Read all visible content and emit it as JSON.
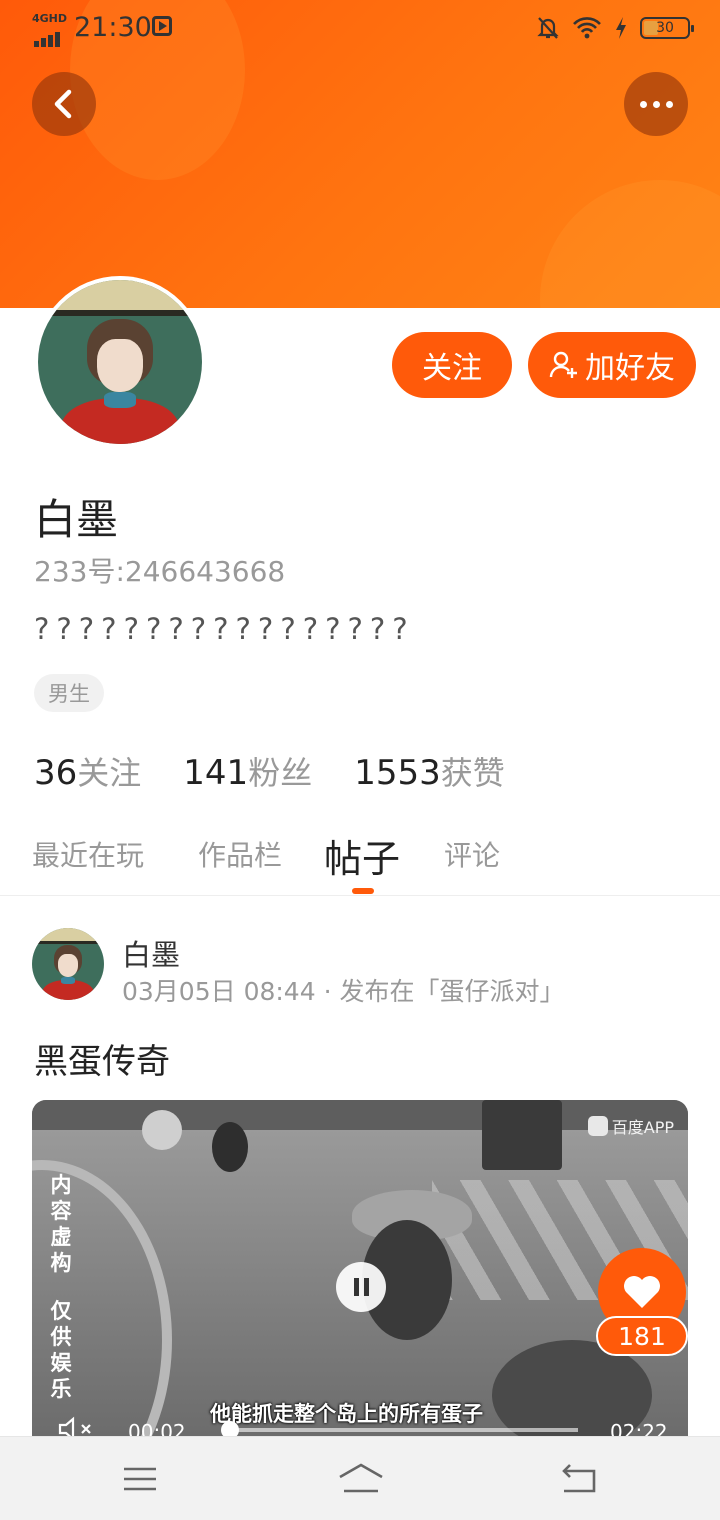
{
  "status_bar": {
    "network": "4GHD",
    "time": "21:30",
    "battery": "30"
  },
  "profile": {
    "name": "白墨",
    "uid_label": "233号:",
    "uid": "246643668",
    "bio": "?????????????????",
    "gender_tag": "男生",
    "follow_button": "关注",
    "add_friend_button": "加好友"
  },
  "stats": [
    {
      "num": "36",
      "label": "关注"
    },
    {
      "num": "141",
      "label": "粉丝"
    },
    {
      "num": "1553",
      "label": "获赞"
    }
  ],
  "tabs": [
    {
      "label": "最近在玩"
    },
    {
      "label": "作品栏"
    },
    {
      "label": "帖子"
    },
    {
      "label": "评论"
    }
  ],
  "post": {
    "author": "白墨",
    "meta": "03月05日 08:44 · 发布在「蛋仔派对」",
    "title": "黑蛋传奇",
    "video": {
      "watermark": "百度APP",
      "side_text_1": [
        "内",
        "容",
        "虚",
        "构"
      ],
      "side_text_2": [
        "仅",
        "供",
        "娱",
        "乐"
      ],
      "caption": "他能抓走整个岛上的所有蛋子",
      "current_time": "00:02",
      "total_time": "02:22",
      "progress": 0.014,
      "likes": "181"
    }
  },
  "colors": {
    "accent": "#ff5a0a",
    "banner_start": "#ff5a0a",
    "banner_end": "#ff8416"
  }
}
